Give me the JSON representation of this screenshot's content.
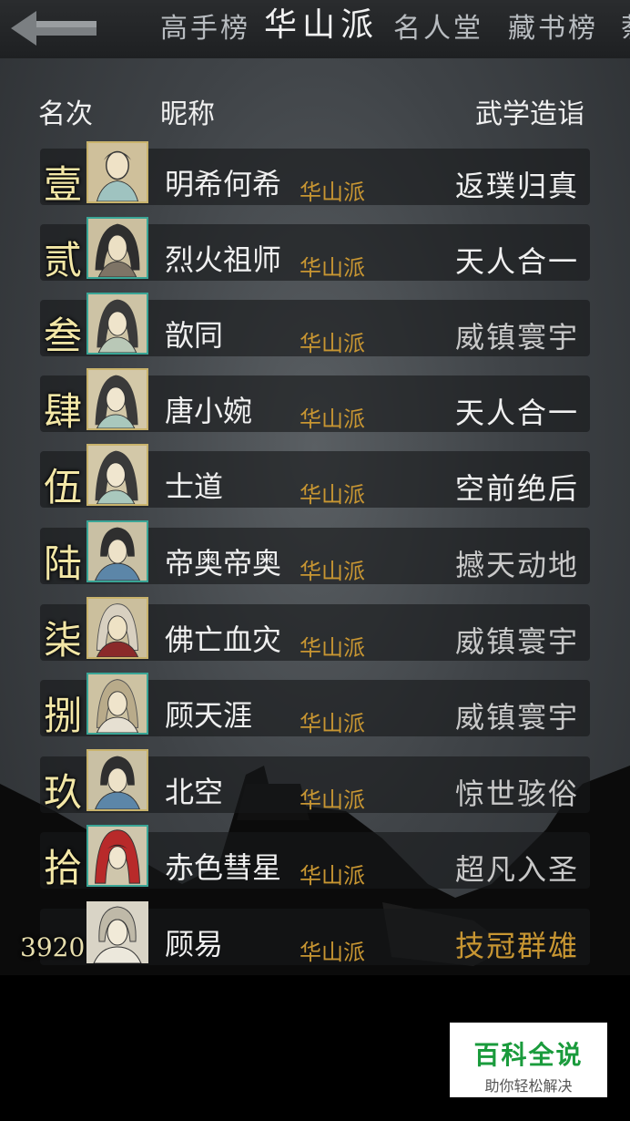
{
  "tabs": [
    {
      "label": "高手榜"
    },
    {
      "label": "华山派"
    },
    {
      "label": "名人堂"
    },
    {
      "label": "藏书榜"
    },
    {
      "label": "萘"
    }
  ],
  "headers": {
    "rank": "名次",
    "nickname": "昵称",
    "level": "武学造诣"
  },
  "rows": [
    {
      "rank": "壹",
      "nickname": "明希何希",
      "sect": "华山派",
      "level": "返璞归真"
    },
    {
      "rank": "贰",
      "nickname": "烈火祖师",
      "sect": "华山派",
      "level": "天人合一"
    },
    {
      "rank": "叁",
      "nickname": "歆同",
      "sect": "华山派",
      "level": "威镇寰宇"
    },
    {
      "rank": "肆",
      "nickname": "唐小婉",
      "sect": "华山派",
      "level": "天人合一"
    },
    {
      "rank": "伍",
      "nickname": "士道",
      "sect": "华山派",
      "level": "空前绝后"
    },
    {
      "rank": "陆",
      "nickname": "帝奥帝奥",
      "sect": "华山派",
      "level": "撼天动地"
    },
    {
      "rank": "柒",
      "nickname": "佛亡血灾",
      "sect": "华山派",
      "level": "威镇寰宇"
    },
    {
      "rank": "捌",
      "nickname": "顾天涯",
      "sect": "华山派",
      "level": "威镇寰宇"
    },
    {
      "rank": "玖",
      "nickname": "北空",
      "sect": "华山派",
      "level": "惊世骇俗"
    },
    {
      "rank": "拾",
      "nickname": "赤色彗星",
      "sect": "华山派",
      "level": "超凡入圣"
    },
    {
      "rank": "3920",
      "nickname": "顾易",
      "sect": "华山派",
      "level": "技冠群雄"
    }
  ],
  "watermark": {
    "title": "百科全说",
    "subtitle": "助你轻松解决"
  },
  "colors": {
    "sect": "#c89632",
    "rank": "#f3e7a6"
  }
}
